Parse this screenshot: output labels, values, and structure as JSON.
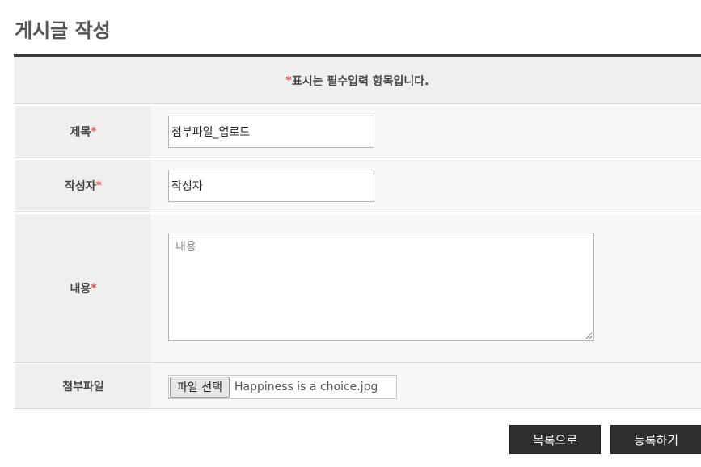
{
  "page": {
    "title": "게시글 작성"
  },
  "notice": {
    "marker": "*",
    "text": " 표시는 필수입력 항목입니다."
  },
  "form": {
    "required_mark": "*",
    "title": {
      "label": "제목",
      "value": "첨부파일_업로드"
    },
    "author": {
      "label": "작성자",
      "value": "작성자"
    },
    "content": {
      "label": "내용",
      "placeholder": "내용"
    },
    "attachment": {
      "label": "첨부파일",
      "button_label": "파일 선택",
      "file_name": "Happiness is a choice.jpg"
    }
  },
  "actions": {
    "list_label": "목록으로",
    "submit_label": "등록하기"
  }
}
